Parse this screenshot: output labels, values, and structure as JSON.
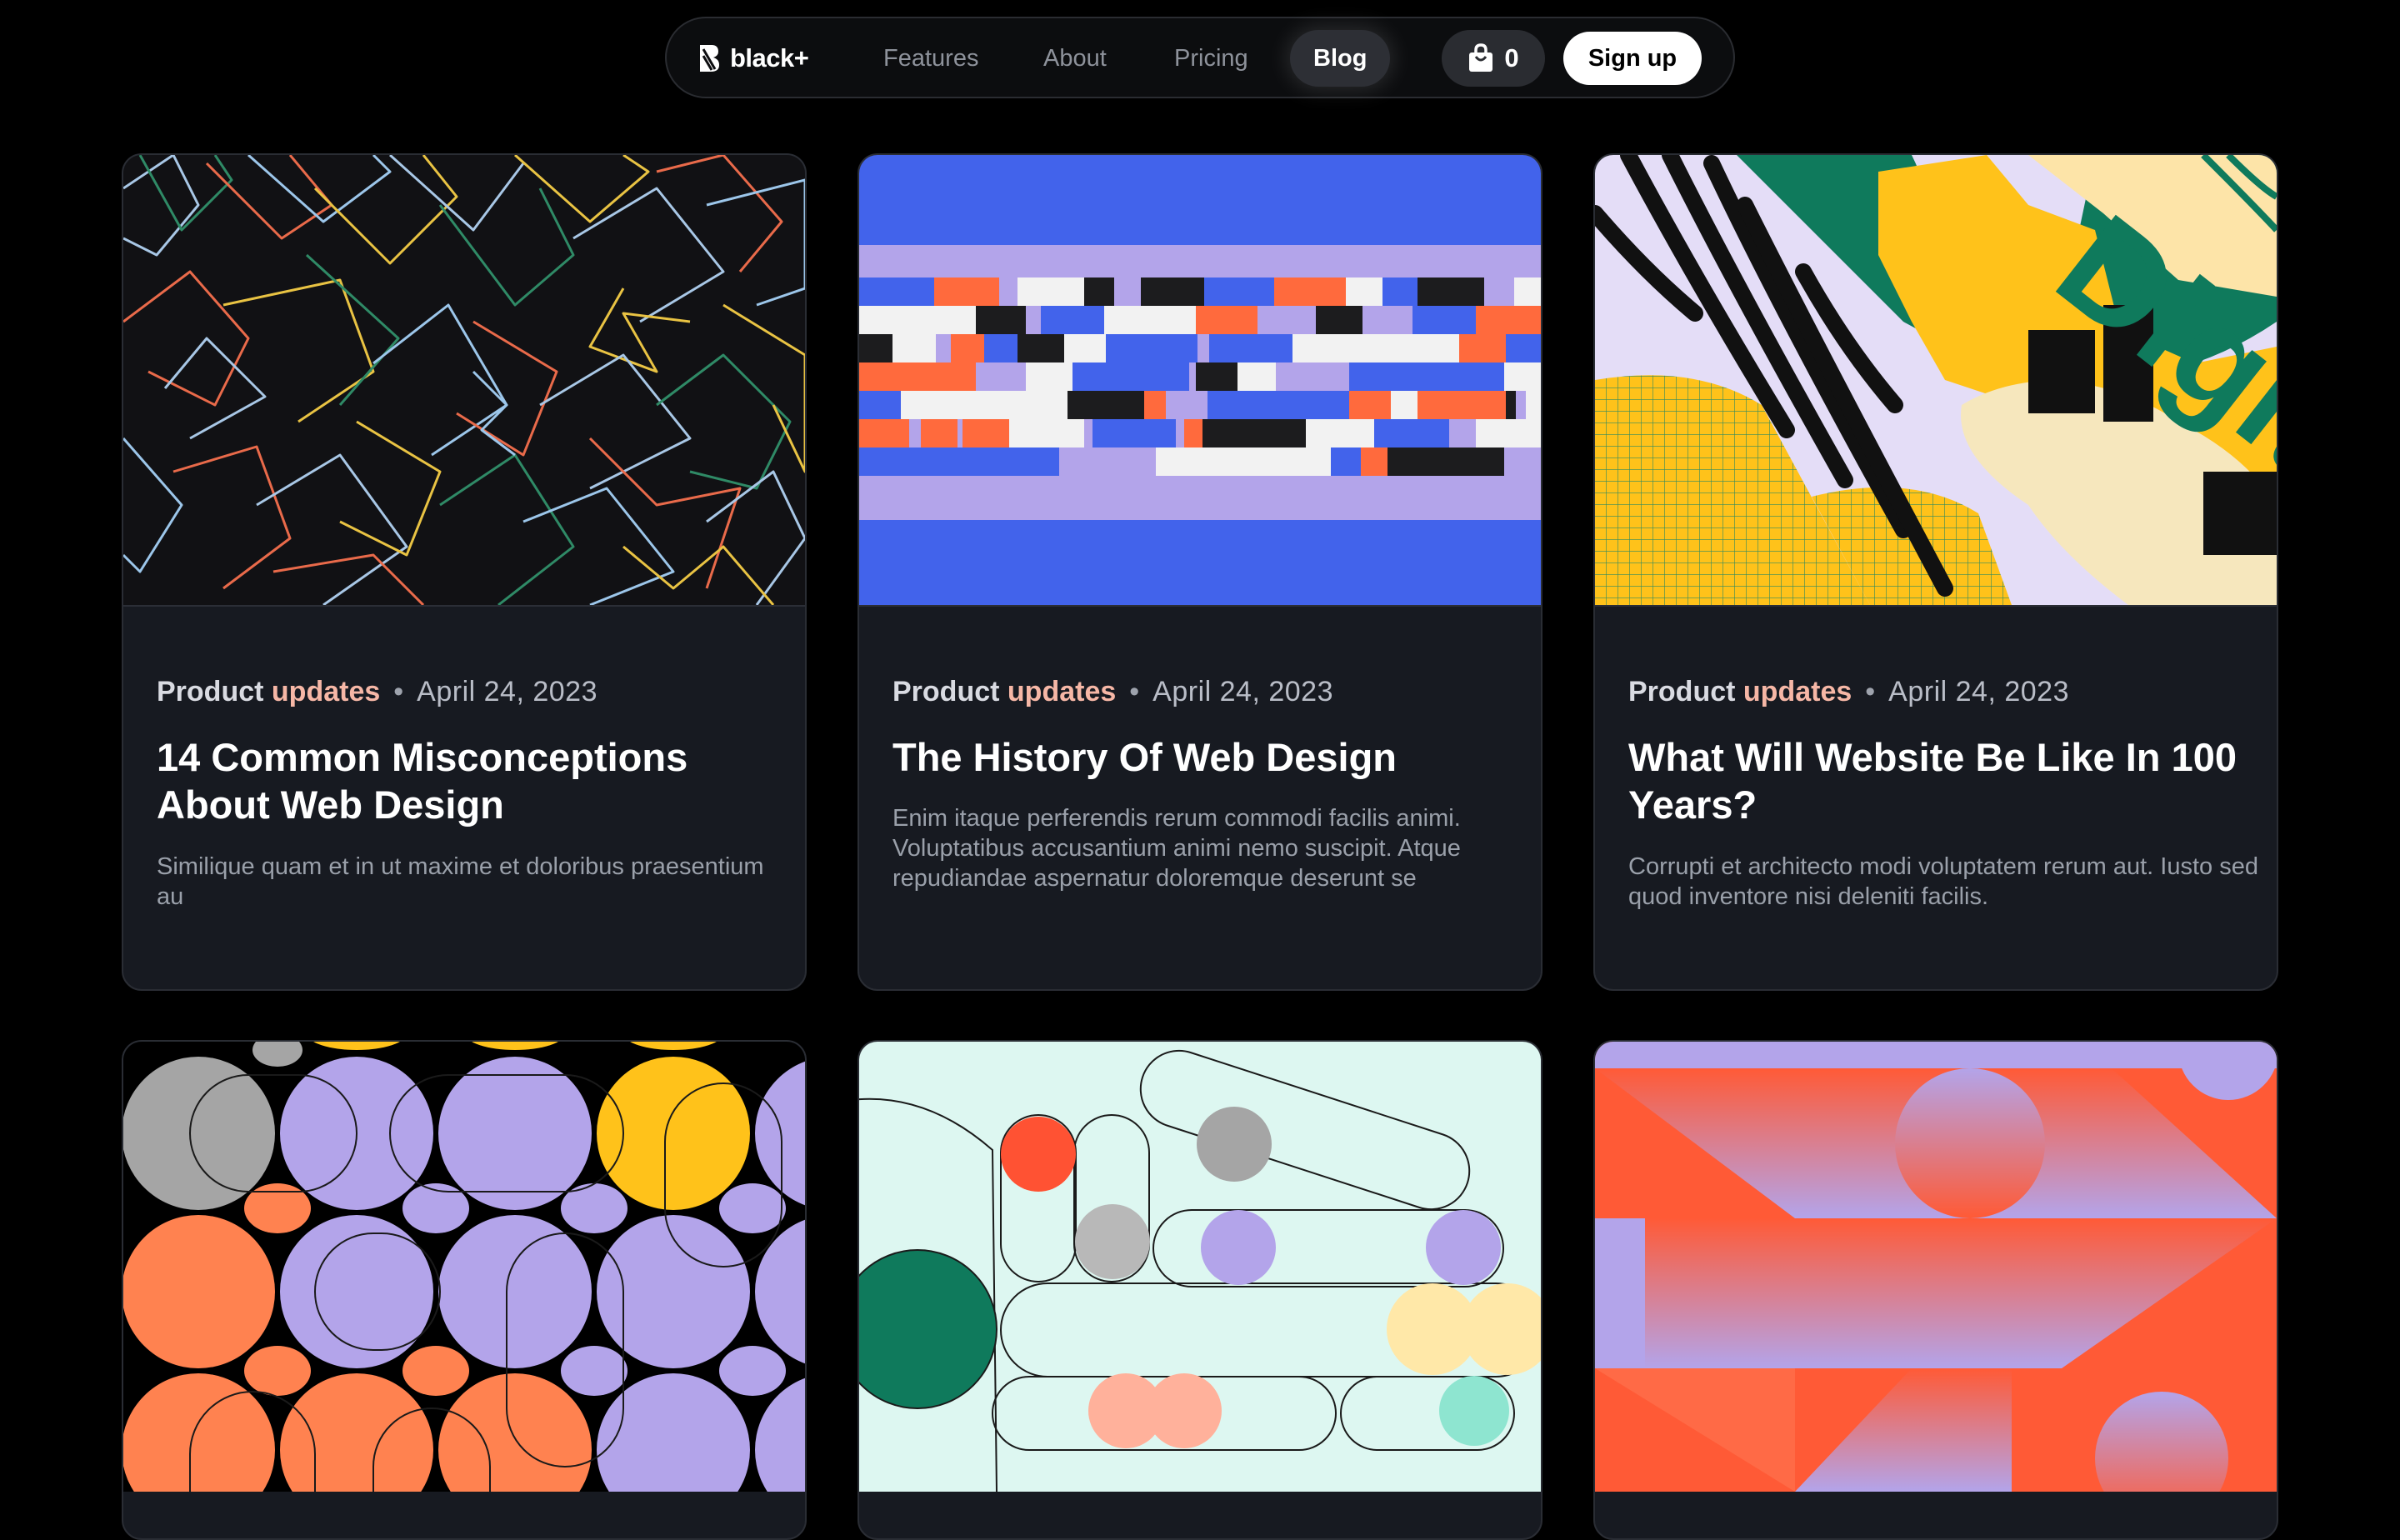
{
  "nav": {
    "brand": "black+",
    "links": [
      "Features",
      "About",
      "Pricing",
      "Blog"
    ],
    "active": "Blog",
    "cart_count": "0",
    "signup_label": "Sign up"
  },
  "posts": [
    {
      "category_first": "Product",
      "category_second": "updates",
      "separator": "•",
      "date": "April 24, 2023",
      "title": "14 Common Misconceptions About Web Design",
      "excerpt": "Similique quam et in ut maxime et doloribus praesentium au"
    },
    {
      "category_first": "Product",
      "category_second": "updates",
      "separator": "•",
      "date": "April 24, 2023",
      "title": "The History Of Web Design",
      "excerpt": "Enim itaque perferendis rerum commodi facilis animi. Voluptatibus accusantium animi nemo suscipit. Atque repudiandae aspernatur doloremque deserunt se"
    },
    {
      "category_first": "Product",
      "category_second": "updates",
      "separator": "•",
      "date": "April 24, 2023",
      "title": "What Will Website Be Like In 100 Years?",
      "excerpt": "Corrupti et architecto modi voluptatem rerum aut. Iusto sed quod inventore nisi deleniti facilis."
    }
  ],
  "colors": {
    "background": "#000000",
    "card": "#171a21",
    "accent_updates": "#f6b7a6",
    "blue": "#4263eb",
    "lavender": "#b3a4ea",
    "orange": "#ff6a3d",
    "yellow": "#ffc21a",
    "green": "#0f7a5c"
  }
}
